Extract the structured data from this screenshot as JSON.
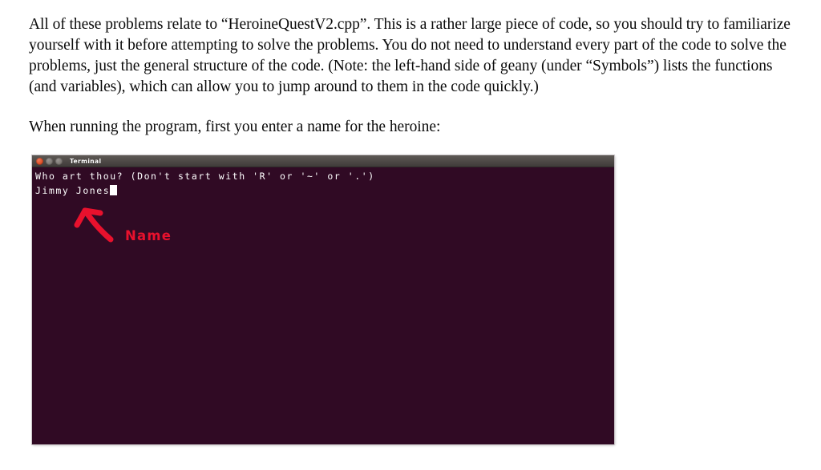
{
  "document": {
    "paragraph_1": "All of these problems relate to “HeroineQuestV2.cpp”.  This is a rather large piece of code, so you should try to familiarize yourself with it before attempting to solve the problems.  You do not need to understand every part of the code to solve the problems, just the general structure of the code.  (Note: the left-hand side of geany (under “Symbols”) lists the functions (and variables), which can allow you to jump around to them in the code quickly.)",
    "paragraph_2": "When running the program, first you enter a name for the heroine:"
  },
  "terminal": {
    "title": "Terminal",
    "background_color": "#300a24",
    "text_color": "#ffffff",
    "window_buttons": [
      {
        "name": "close",
        "color": "#e0522a"
      },
      {
        "name": "minimize",
        "color": "#7d7874"
      },
      {
        "name": "maximize",
        "color": "#7d7874"
      }
    ],
    "lines": [
      "Who art thou? (Don't start with 'R' or '~' or '.')",
      "Jimmy Jones"
    ],
    "cursor": "block"
  },
  "annotation": {
    "label": "Name",
    "color": "#e8112d",
    "arrow": "curved-arrow-up-left"
  }
}
